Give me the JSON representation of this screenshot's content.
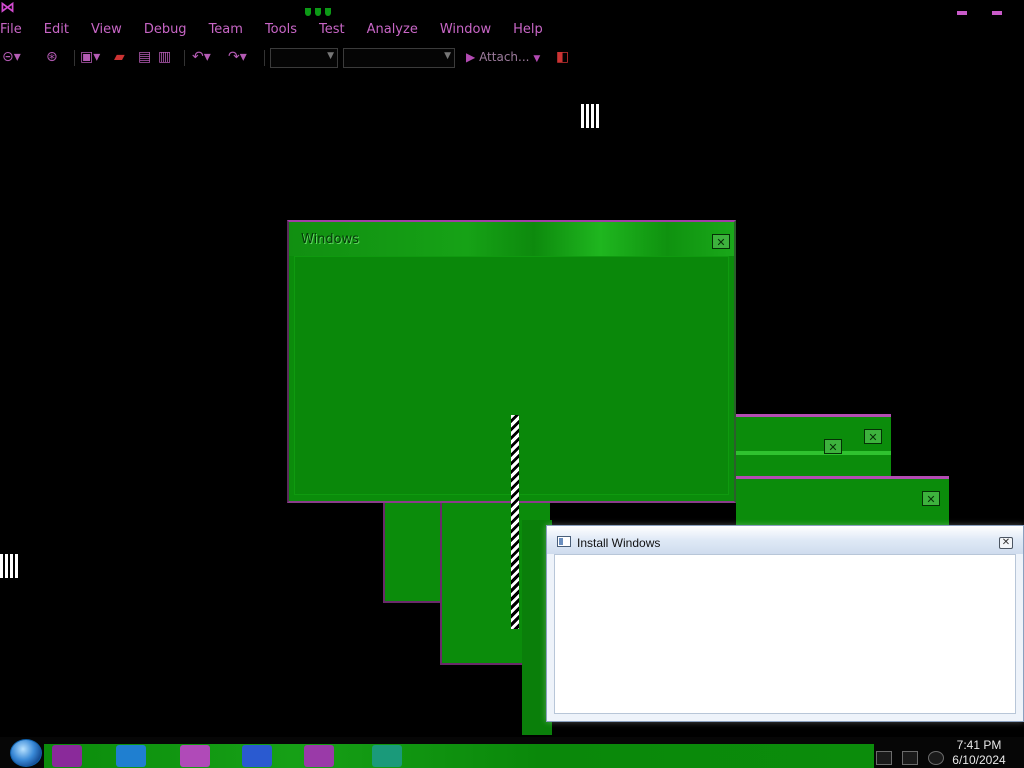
{
  "menubar": {
    "items": [
      {
        "label": "File"
      },
      {
        "label": "Edit"
      },
      {
        "label": "View"
      },
      {
        "label": "Debug"
      },
      {
        "label": "Team"
      },
      {
        "label": "Tools"
      },
      {
        "label": "Test"
      },
      {
        "label": "Analyze"
      },
      {
        "label": "Window"
      },
      {
        "label": "Help"
      }
    ]
  },
  "toolbar": {
    "attach_label": "Attach..."
  },
  "windows_dialog": {
    "title": "Windows"
  },
  "install_dialog": {
    "title": "Install Windows"
  },
  "taskbar": {
    "time": "7:41 PM",
    "date": "6/10/2024"
  },
  "colors": {
    "menu_text": "#c866c6",
    "glitch_green": "#0b8c0b",
    "glitch_magenta": "#b34cb3",
    "dialog_bg": "#eef3fa"
  }
}
